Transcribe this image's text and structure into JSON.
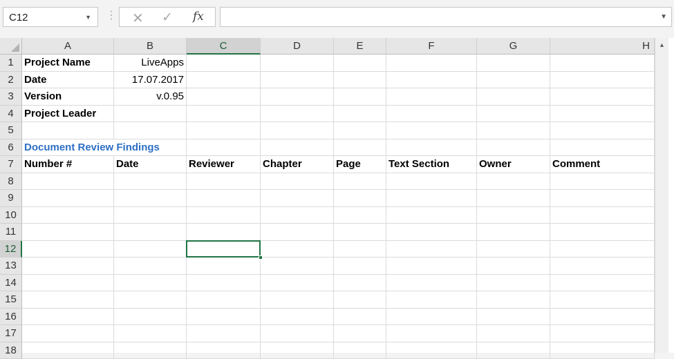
{
  "formula_bar": {
    "name_box": "C12",
    "formula": "",
    "fx_label": "fx",
    "cancel_glyph": "✕",
    "enter_glyph": "✓"
  },
  "columns": [
    "A",
    "B",
    "C",
    "D",
    "E",
    "F",
    "G",
    "H"
  ],
  "active_column": "C",
  "active_row": "12",
  "rows": [
    "1",
    "2",
    "3",
    "4",
    "5",
    "6",
    "7",
    "8",
    "9",
    "10",
    "11",
    "12",
    "13",
    "14",
    "15",
    "16",
    "17",
    "18"
  ],
  "cells": {
    "A1": "Project Name",
    "B1": "LiveApps",
    "A2": "Date",
    "B2": "17.07.2017",
    "A3": "Version",
    "B3": "v.0.95",
    "A4": "Project Leader",
    "A6": "Document Review Findings",
    "A7": "Number #",
    "B7": "Date",
    "C7": "Reviewer",
    "D7": "Chapter",
    "E7": "Page",
    "F7": "Text Section",
    "G7": "Owner",
    "H7": "Comment"
  },
  "colors": {
    "accent": "#217346",
    "title_blue": "#2e6fc4"
  }
}
